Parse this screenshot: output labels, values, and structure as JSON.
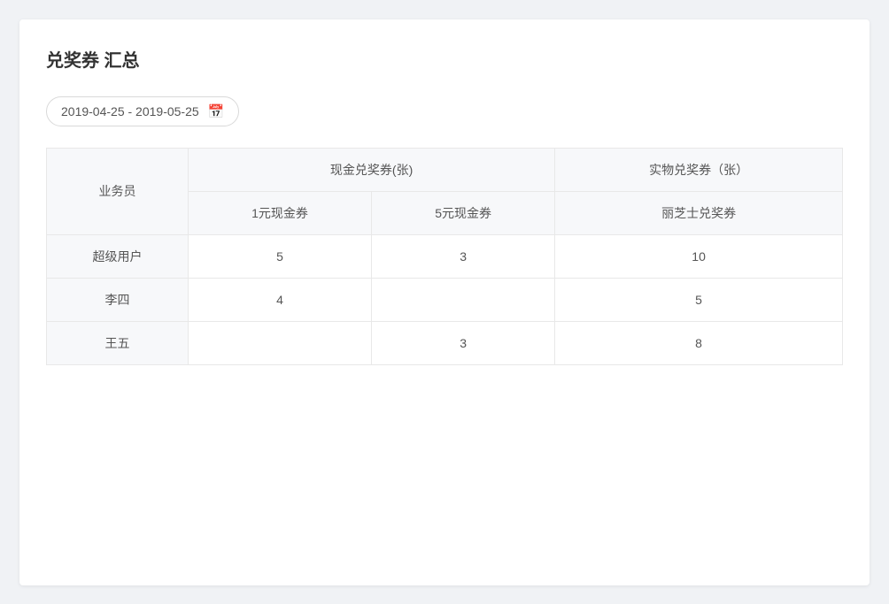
{
  "page": {
    "title": "兑奖券 汇总",
    "date_range": "2019-04-25 - 2019-05-25"
  },
  "table": {
    "col_agent": "业务员",
    "cash_coupon_group": "现金兑奖券(张)",
    "physical_coupon_group": "实物兑奖券（张）",
    "col_1yuan": "1元现金券",
    "col_5yuan": "5元现金券",
    "col_lizhi": "丽芝士兑奖券",
    "rows": [
      {
        "agent": "超级用户",
        "val_1yuan": "5",
        "val_5yuan": "3",
        "val_lizhi": "10"
      },
      {
        "agent": "李四",
        "val_1yuan": "4",
        "val_5yuan": "",
        "val_lizhi": "5"
      },
      {
        "agent": "王五",
        "val_1yuan": "",
        "val_5yuan": "3",
        "val_lizhi": "8"
      }
    ]
  }
}
